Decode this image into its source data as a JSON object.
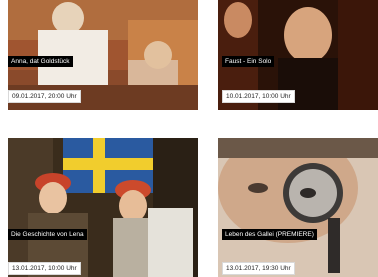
{
  "events": [
    {
      "title": "Anna, dat Goldstück",
      "date": "09.01.2017, 20:00 Uhr"
    },
    {
      "title": "Faust - Ein Solo",
      "date": "10.01.2017, 10:00 Uhr"
    },
    {
      "title": "Die Geschichte von Lena",
      "date": "13.01.2017, 10:00 Uhr"
    },
    {
      "title": "Leben des Gallei (PREMIERE)",
      "date": "13.01.2017, 19:30 Uhr"
    }
  ],
  "colors": {
    "label_bg": "#000000",
    "label_text": "#ffffff",
    "date_bg": "#ffffff",
    "date_text": "#222222"
  },
  "icons": [
    "event-photo-stage",
    "event-photo-portrait",
    "event-photo-flag",
    "event-photo-magnifier"
  ]
}
